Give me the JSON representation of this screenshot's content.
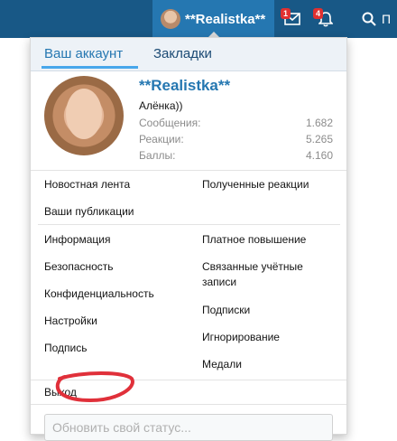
{
  "navbar": {
    "username": "**Realistka**",
    "inbox_badge": "1",
    "alerts_badge": "4",
    "search_icon": "search-icon",
    "inbox_icon": "envelope-icon",
    "alerts_icon": "bell-icon"
  },
  "tabs": [
    {
      "label": "Ваш аккаунт",
      "active": true
    },
    {
      "label": "Закладки",
      "active": false
    }
  ],
  "profile": {
    "name": "**Realistka**",
    "user_title": "Алёнка))",
    "stats": [
      {
        "label": "Сообщения:",
        "value": "1.682"
      },
      {
        "label": "Реакции:",
        "value": "5.265"
      },
      {
        "label": "Баллы:",
        "value": "4.160"
      }
    ]
  },
  "menu": {
    "group1_left": [
      "Новостная лента",
      "Ваши публикации"
    ],
    "group1_right": [
      "Полученные реакции"
    ],
    "group2_left": [
      "Информация",
      "Безопасность",
      "Конфиденциальность",
      "Настройки",
      "Подпись"
    ],
    "group2_right": [
      "Платное повышение",
      "Связанные учётные записи",
      "Подписки",
      "Игнорирование",
      "Медали"
    ],
    "logout": "Выход"
  },
  "status_input": {
    "placeholder": "Обновить свой статус..."
  },
  "colors": {
    "navbar": "#185886",
    "accent": "#2577b1",
    "annotation": "#e0303a"
  }
}
